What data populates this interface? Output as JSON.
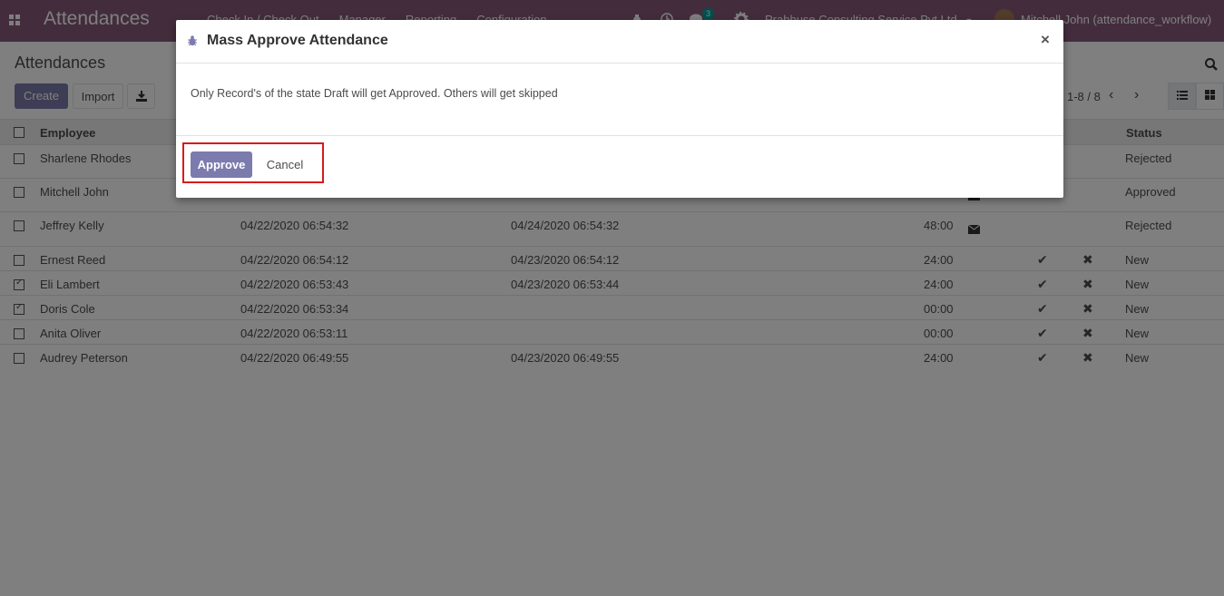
{
  "navbar": {
    "app_title": "Attendances",
    "menu": [
      "Check In / Check Out",
      "Manager",
      "Reporting",
      "Configuration"
    ],
    "messages_count": "3",
    "company": "Prabhuse Consulting Service Pvt Ltd",
    "user": "Mitchell John (attendance_workflow)",
    "icons": [
      "apps-icon",
      "bug-icon",
      "clock-icon",
      "chat-icon",
      "gear-icon",
      "caret-down-icon"
    ]
  },
  "control_panel": {
    "breadcrumb": "Attendances",
    "create_label": "Create",
    "import_label": "Import",
    "pager": "1-8 / 8"
  },
  "list": {
    "headers": {
      "employee": "Employee",
      "status": "Status"
    },
    "rows": [
      {
        "employee": "Sharlene Rhodes",
        "check_in": "",
        "check_out": "",
        "hours": "",
        "status": "Rejected",
        "checked": false,
        "envelope": false,
        "actions": false
      },
      {
        "employee": "Mitchell John",
        "check_in": "",
        "check_out": "",
        "hours": "",
        "status": "Approved",
        "checked": false,
        "envelope": true,
        "actions": false
      },
      {
        "employee": "Jeffrey Kelly",
        "check_in": "04/22/2020 06:54:32",
        "check_out": "04/24/2020 06:54:32",
        "hours": "48:00",
        "status": "Rejected",
        "checked": false,
        "envelope": true,
        "actions": false
      },
      {
        "employee": "Ernest Reed",
        "check_in": "04/22/2020 06:54:12",
        "check_out": "04/23/2020 06:54:12",
        "hours": "24:00",
        "status": "New",
        "checked": false,
        "envelope": false,
        "actions": true
      },
      {
        "employee": "Eli Lambert",
        "check_in": "04/22/2020 06:53:43",
        "check_out": "04/23/2020 06:53:44",
        "hours": "24:00",
        "status": "New",
        "checked": true,
        "envelope": false,
        "actions": true
      },
      {
        "employee": "Doris Cole",
        "check_in": "04/22/2020 06:53:34",
        "check_out": "",
        "hours": "00:00",
        "status": "New",
        "checked": true,
        "envelope": false,
        "actions": true
      },
      {
        "employee": "Anita Oliver",
        "check_in": "04/22/2020 06:53:11",
        "check_out": "",
        "hours": "00:00",
        "status": "New",
        "checked": false,
        "envelope": false,
        "actions": true
      },
      {
        "employee": "Audrey Peterson",
        "check_in": "04/22/2020 06:49:55",
        "check_out": "04/23/2020 06:49:55",
        "hours": "24:00",
        "status": "New",
        "checked": false,
        "envelope": false,
        "actions": true
      }
    ]
  },
  "dialog": {
    "title": "Mass Approve Attendance",
    "close_symbol": "×",
    "message": "Only Record's of the state Draft will get Approved. Others will get skipped",
    "approve_label": "Approve",
    "cancel_label": "Cancel"
  },
  "colors": {
    "brand": "#875a7b",
    "primary_button": "#7c7bad",
    "highlight_box": "#d81b1b",
    "badge": "#00a09d"
  }
}
